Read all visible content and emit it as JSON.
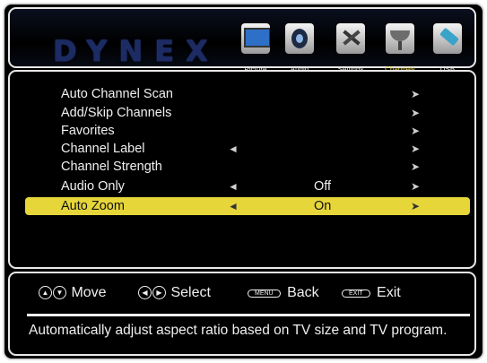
{
  "brand": {
    "logo": "DYNEX"
  },
  "tabs": [
    {
      "label": "Picture",
      "icon": "tv-icon"
    },
    {
      "label": "Audio",
      "icon": "speaker-icon"
    },
    {
      "label": "Settings",
      "icon": "tools-icon"
    },
    {
      "label": "Channels",
      "icon": "satellite-dish-icon",
      "active": true
    },
    {
      "label": "USB",
      "icon": "usb-stick-icon"
    }
  ],
  "menu": {
    "items": [
      {
        "name": "Auto Channel Scan",
        "value": ""
      },
      {
        "name": "Add/Skip Channels",
        "value": ""
      },
      {
        "name": "Favorites",
        "value": ""
      },
      {
        "name": "Channel Label",
        "value": ""
      },
      {
        "name": "Channel Strength",
        "value": ""
      },
      {
        "name": "Audio Only",
        "value": "Off"
      },
      {
        "name": "Auto Zoom",
        "value": "On",
        "selected": true
      }
    ]
  },
  "footer": {
    "move_label": "Move",
    "select_label": "Select",
    "menu_key": "MENU",
    "back_label": "Back",
    "exit_key": "EXIT",
    "exit_label": "Exit",
    "description": "Automatically adjust aspect ratio based on TV size and TV program."
  },
  "colors": {
    "highlight": "#e6d63a",
    "active_tab": "#e9d54a",
    "logo": "#1c2b63"
  }
}
